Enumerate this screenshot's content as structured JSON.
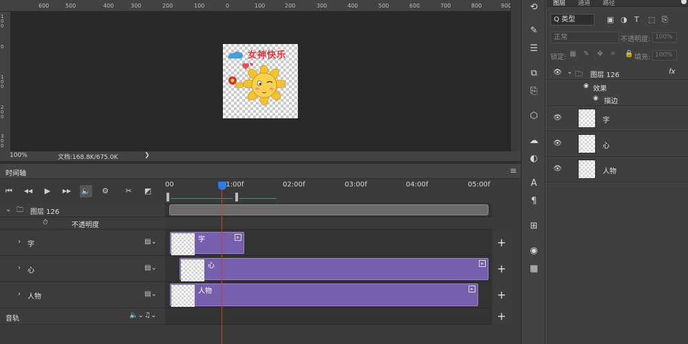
{
  "ruler": {
    "ticks": [
      "600",
      "500",
      "400",
      "300",
      "200",
      "100",
      "0",
      "100",
      "200",
      "300",
      "400",
      "500",
      "600",
      "700",
      "800",
      "900"
    ],
    "left_ticks": [
      "100",
      "0",
      "100",
      "200",
      "300"
    ]
  },
  "document": {
    "title_text": "女神快乐"
  },
  "status": {
    "zoom": "100%",
    "doc_info": "文档:168.8K/675.0K",
    "arrow": "❯"
  },
  "timeline": {
    "panel_title": "时间轴",
    "menu_icon": "≡",
    "time_labels": [
      "00",
      "01:00f",
      "02:00f",
      "03:00f",
      "04:00f",
      "05:00f"
    ],
    "controls": {
      "first": "⏮",
      "prev": "◀◀",
      "play": "▶",
      "next": "▶▶",
      "audio": "🔈",
      "settings": "⚙",
      "cut": "✂",
      "transition": "◩"
    },
    "group": {
      "name": "图层 126",
      "property": "不透明度"
    },
    "tracks": [
      {
        "name": "字",
        "clip_label": "字"
      },
      {
        "name": "心",
        "clip_label": "心"
      },
      {
        "name": "人物",
        "clip_label": "人物"
      }
    ],
    "audio_track": {
      "name": "音轨"
    },
    "add_label": "+"
  },
  "layers_panel": {
    "tabs": [
      "图层",
      "通道",
      "路径"
    ],
    "filter": "Q 类型",
    "blend_mode": "正常",
    "opacity_label": "不透明度:",
    "opacity_value": "100%",
    "lock_label": "锁定:",
    "fill_label": "填充:",
    "fill_value": "100%",
    "group_name": "图层 126",
    "fx_label": "fx",
    "effects_label": "效果",
    "stroke_label": "描边",
    "layers": [
      {
        "name": "字"
      },
      {
        "name": "心"
      },
      {
        "name": "人物"
      }
    ]
  },
  "colors": {
    "clip": "#7660ae",
    "playhead": "#d23a3a",
    "accent": "#2d7cf0"
  }
}
